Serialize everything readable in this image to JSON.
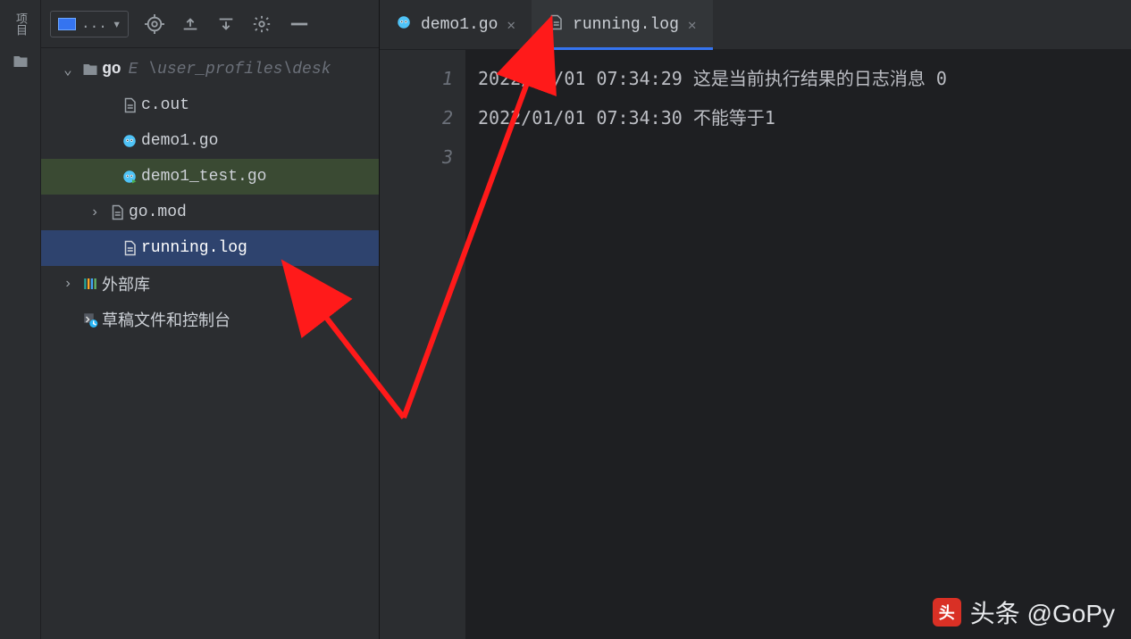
{
  "left_gutter": {
    "label": "项目",
    "folder_icon": "folder"
  },
  "toolbar": {
    "selector_label": "...",
    "target_icon": "target",
    "expand_icon": "expand",
    "collapse_icon": "collapse",
    "settings_icon": "settings",
    "hide_icon": "hide"
  },
  "tree": {
    "root": {
      "name": "go",
      "path": "E \\user_profiles\\desk"
    },
    "items": [
      {
        "name": "c.out",
        "type": "file"
      },
      {
        "name": "demo1.go",
        "type": "go"
      },
      {
        "name": "demo1_test.go",
        "type": "gotest"
      },
      {
        "name": "go.mod",
        "type": "file",
        "expandable": true
      },
      {
        "name": "running.log",
        "type": "file",
        "selected": true
      }
    ],
    "external_lib": "外部库",
    "scratch": "草稿文件和控制台"
  },
  "tabs": [
    {
      "label": "demo1.go",
      "type": "go",
      "active": false
    },
    {
      "label": "running.log",
      "type": "file",
      "active": true
    }
  ],
  "editor": {
    "line_numbers": [
      "1",
      "2",
      "3"
    ],
    "lines": [
      "2022/01/01 07:34:29 这是当前执行结果的日志消息 0",
      "2022/01/01 07:34:30 不能等于1",
      ""
    ]
  },
  "watermark": "头条 @GoPy"
}
